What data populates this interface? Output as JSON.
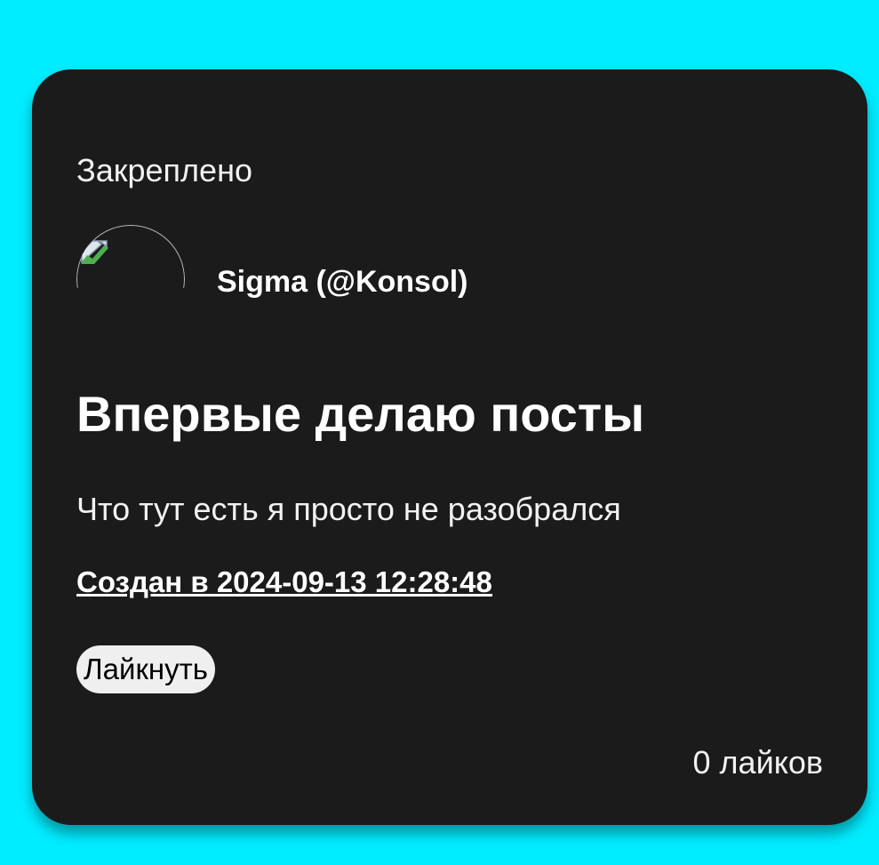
{
  "post": {
    "pinned_label": "Закреплено",
    "avatar_icon": "broken-image-icon",
    "author": "Sigma (@Konsol)",
    "title": "Впервые делаю посты",
    "body": "Что тут есть я просто не разобрался",
    "created": "Создан в 2024-09-13 12:28:48",
    "like_button_label": "Лайкнуть",
    "likes_count": "0 лайков"
  },
  "colors": {
    "page_background": "#00ecff",
    "card_background": "#1b1b1b",
    "text": "#ffffff",
    "button_background": "#efefef"
  }
}
